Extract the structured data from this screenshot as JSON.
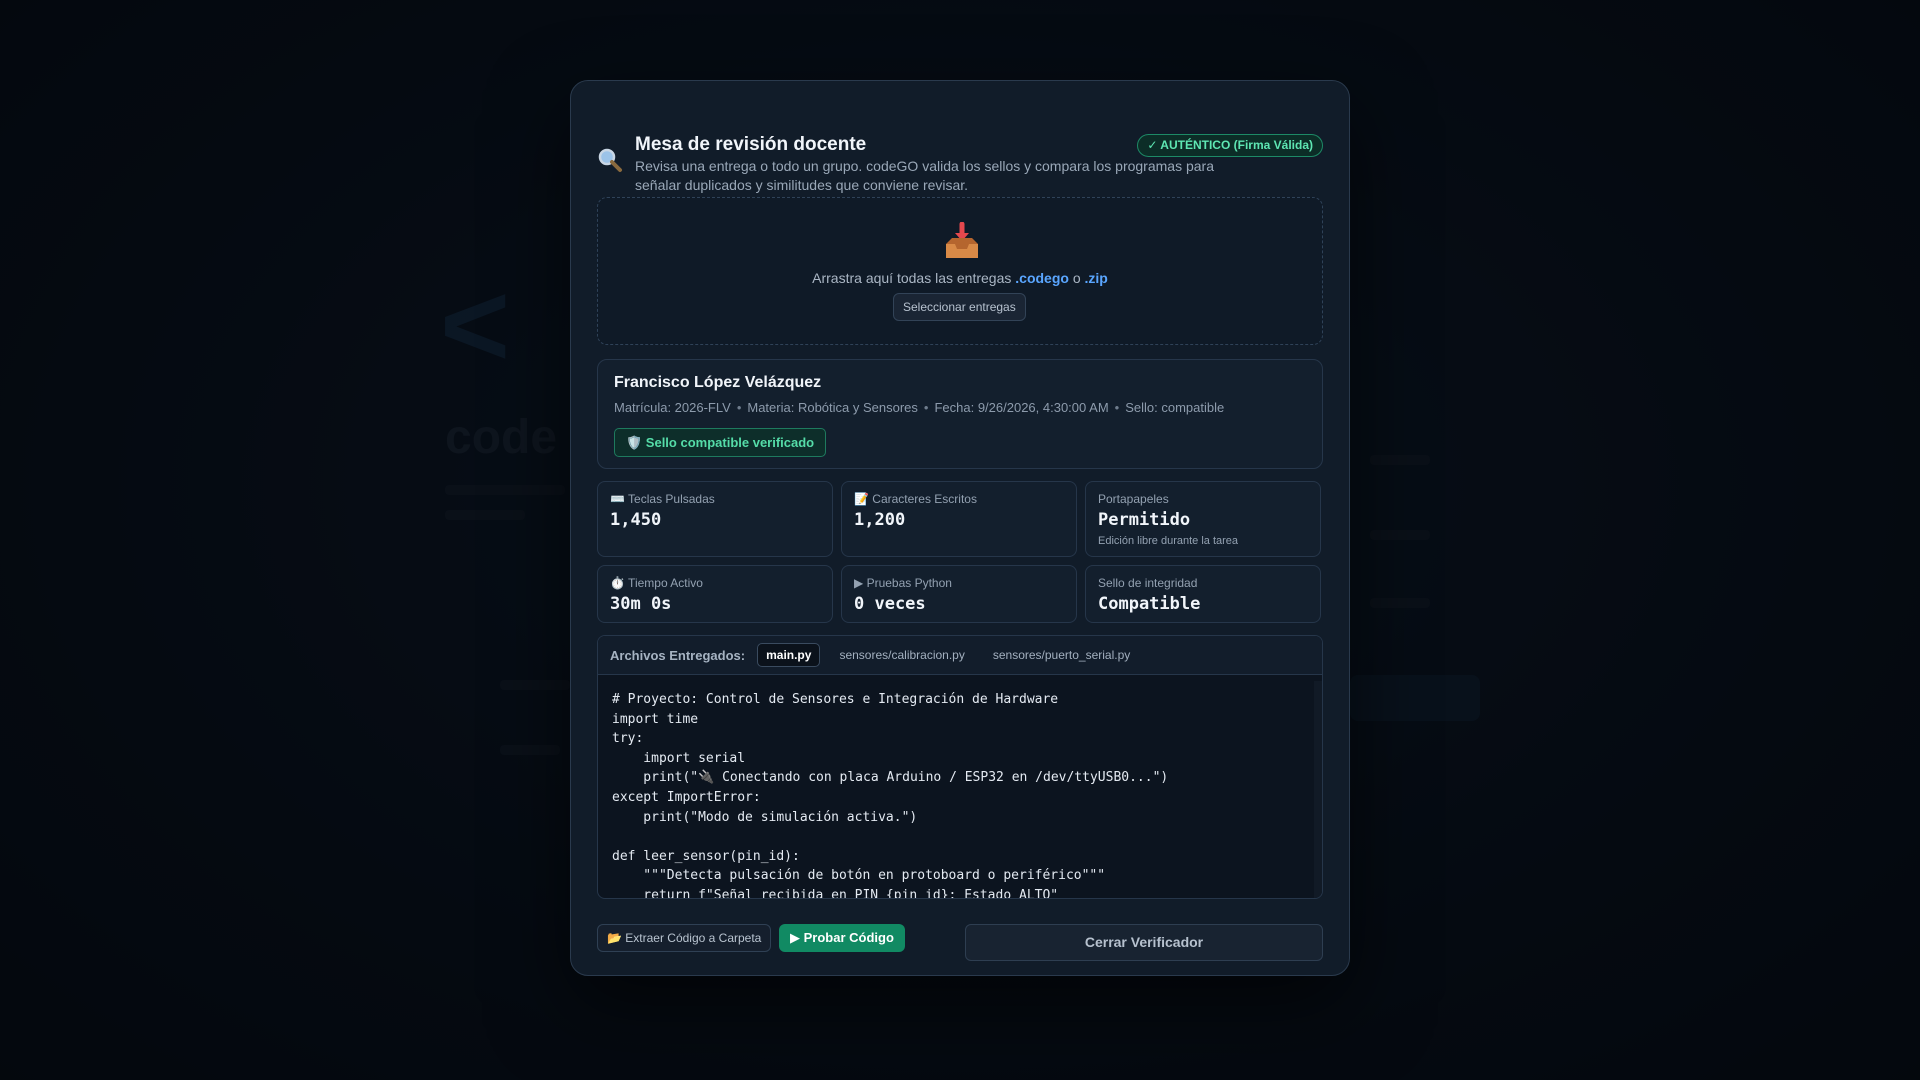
{
  "background": {
    "app_title": "code"
  },
  "modal": {
    "title": "Mesa de revisión docente",
    "subtitle": "Revisa una entrega o todo un grupo. codeGO valida los sellos y compara los programas para señalar duplicados y similitudes que conviene revisar.",
    "badge": "✓ AUTÉNTICO (Firma Válida)",
    "icon": "magnifier-icon"
  },
  "dropzone": {
    "icon": "inbox-tray-icon",
    "text_prefix": "Arrastra aquí todas las entregas",
    "ext_codego": ".codego",
    "text_or": "o",
    "ext_zip": ".zip",
    "select_label": "Seleccionar entregas"
  },
  "student": {
    "name": "Francisco López Velázquez",
    "matricula": "Matrícula: 2026-FLV",
    "materia": "Materia: Robótica y Sensores",
    "fecha": "Fecha: 9/26/2026, 4:30:00 AM",
    "sello": "Sello: compatible",
    "seal_badge": "🛡️ Sello compatible verificado"
  },
  "stats": {
    "keys_label": "⌨️ Teclas Pulsadas",
    "keys_value": "1,450",
    "chars_label": "📝 Caracteres Escritos",
    "chars_value": "1,200",
    "clipboard_label": "Portapapeles",
    "clipboard_value": "Permitido",
    "clipboard_note": "Edición libre durante la tarea",
    "time_label": "⏱️ Tiempo Activo",
    "time_value": "30m 0s",
    "tests_label": "▶ Pruebas Python",
    "tests_value": "0 veces",
    "seal_label": "Sello de integridad",
    "seal_value": "Compatible"
  },
  "files": {
    "label": "Archivos Entregados:",
    "tabs": [
      "main.py",
      "sensores/calibracion.py",
      "sensores/puerto_serial.py"
    ],
    "active_tab": "main.py",
    "code": "# Proyecto: Control de Sensores e Integración de Hardware\nimport time\ntry:\n    import serial\n    print(\"🔌 Conectando con placa Arduino / ESP32 en /dev/ttyUSB0...\")\nexcept ImportError:\n    print(\"Modo de simulación activa.\")\n\ndef leer_sensor(pin_id):\n    \"\"\"Detecta pulsación de botón en protoboard o periférico\"\"\"\n    return f\"Señal recibida en PIN {pin_id}: Estado ALTO\""
  },
  "actions": {
    "extract_label": "📂 Extraer Código a Carpeta",
    "run_label": "▶ Probar Código",
    "close_label": "Cerrar Verificador"
  },
  "colors": {
    "accent_green": "#118a63",
    "link_blue": "#5aa6ff",
    "badge_green": "#5ee6b3"
  }
}
